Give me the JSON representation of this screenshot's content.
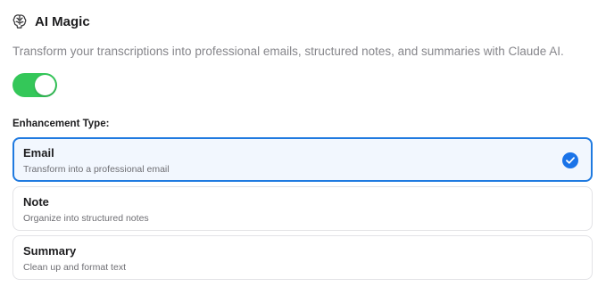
{
  "section": {
    "title": "AI Magic",
    "icon": "brain-icon",
    "description": "Transform your transcriptions into professional emails, structured notes, and summaries with Claude AI."
  },
  "toggle": {
    "enabled": true,
    "color": "#34c759"
  },
  "enhancement": {
    "label": "Enhancement Type:",
    "selected": "Email",
    "options": [
      {
        "title": "Email",
        "description": "Transform into a professional email"
      },
      {
        "title": "Note",
        "description": "Organize into structured notes"
      },
      {
        "title": "Summary",
        "description": "Clean up and format text"
      }
    ]
  },
  "colors": {
    "accent": "#1a73e8",
    "toggle_on": "#34c759"
  }
}
